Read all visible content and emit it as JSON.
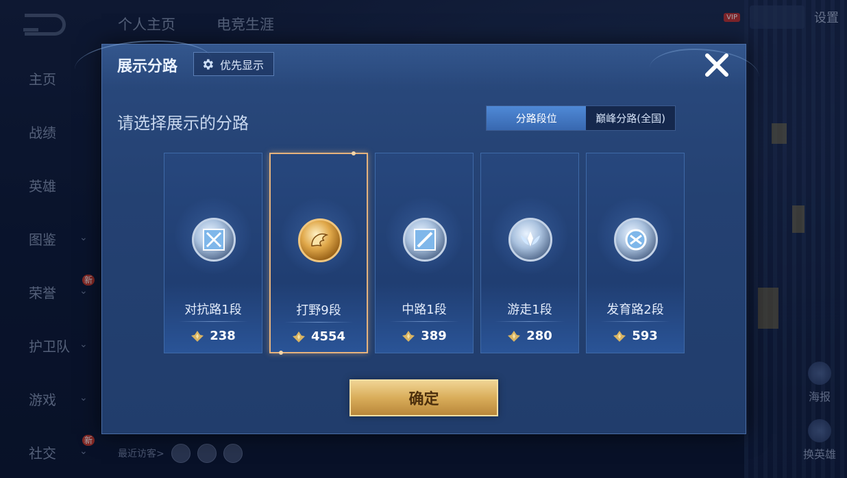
{
  "background": {
    "top_tabs": [
      "个人主页",
      "电竞生涯"
    ],
    "settings_label": "设置",
    "vip_label": "VIP",
    "side_nav": [
      {
        "label": "主页",
        "chevron": false,
        "new": false
      },
      {
        "label": "战绩",
        "chevron": false,
        "new": false
      },
      {
        "label": "英雄",
        "chevron": false,
        "new": false
      },
      {
        "label": "图鉴",
        "chevron": true,
        "new": false
      },
      {
        "label": "荣誉",
        "chevron": true,
        "new": true
      },
      {
        "label": "护卫队",
        "chevron": true,
        "new": false
      },
      {
        "label": "游戏",
        "chevron": true,
        "new": false
      },
      {
        "label": "社交",
        "chevron": true,
        "new": true
      }
    ],
    "new_badge": "新",
    "right_items": [
      "海报",
      "换英雄"
    ],
    "recent_visitors_label": "最近访客>"
  },
  "modal": {
    "title": "展示分路",
    "priority_button": "优先显示",
    "subtitle": "请选择展示的分路",
    "segment": {
      "options": [
        "分路段位",
        "巅峰分路(全国)"
      ],
      "selected": "分路段位"
    },
    "cards": [
      {
        "rank": "对抗路1段",
        "score": "238",
        "medal": "silver",
        "emblem": "cross-swords-icon",
        "selected": false
      },
      {
        "rank": "打野9段",
        "score": "4554",
        "medal": "gold",
        "emblem": "dragon-icon",
        "selected": true
      },
      {
        "rank": "中路1段",
        "score": "389",
        "medal": "silver",
        "emblem": "slash-square-icon",
        "selected": false
      },
      {
        "rank": "游走1段",
        "score": "280",
        "medal": "silver",
        "emblem": "wings-icon",
        "selected": false
      },
      {
        "rank": "发育路2段",
        "score": "593",
        "medal": "silver",
        "emblem": "bow-circle-icon",
        "selected": false
      }
    ],
    "confirm_button": "确定"
  },
  "colors": {
    "accent_blue": "#4f89d6",
    "gold_border": "#e6b37d",
    "confirm_gold": "#d9ad5a"
  }
}
